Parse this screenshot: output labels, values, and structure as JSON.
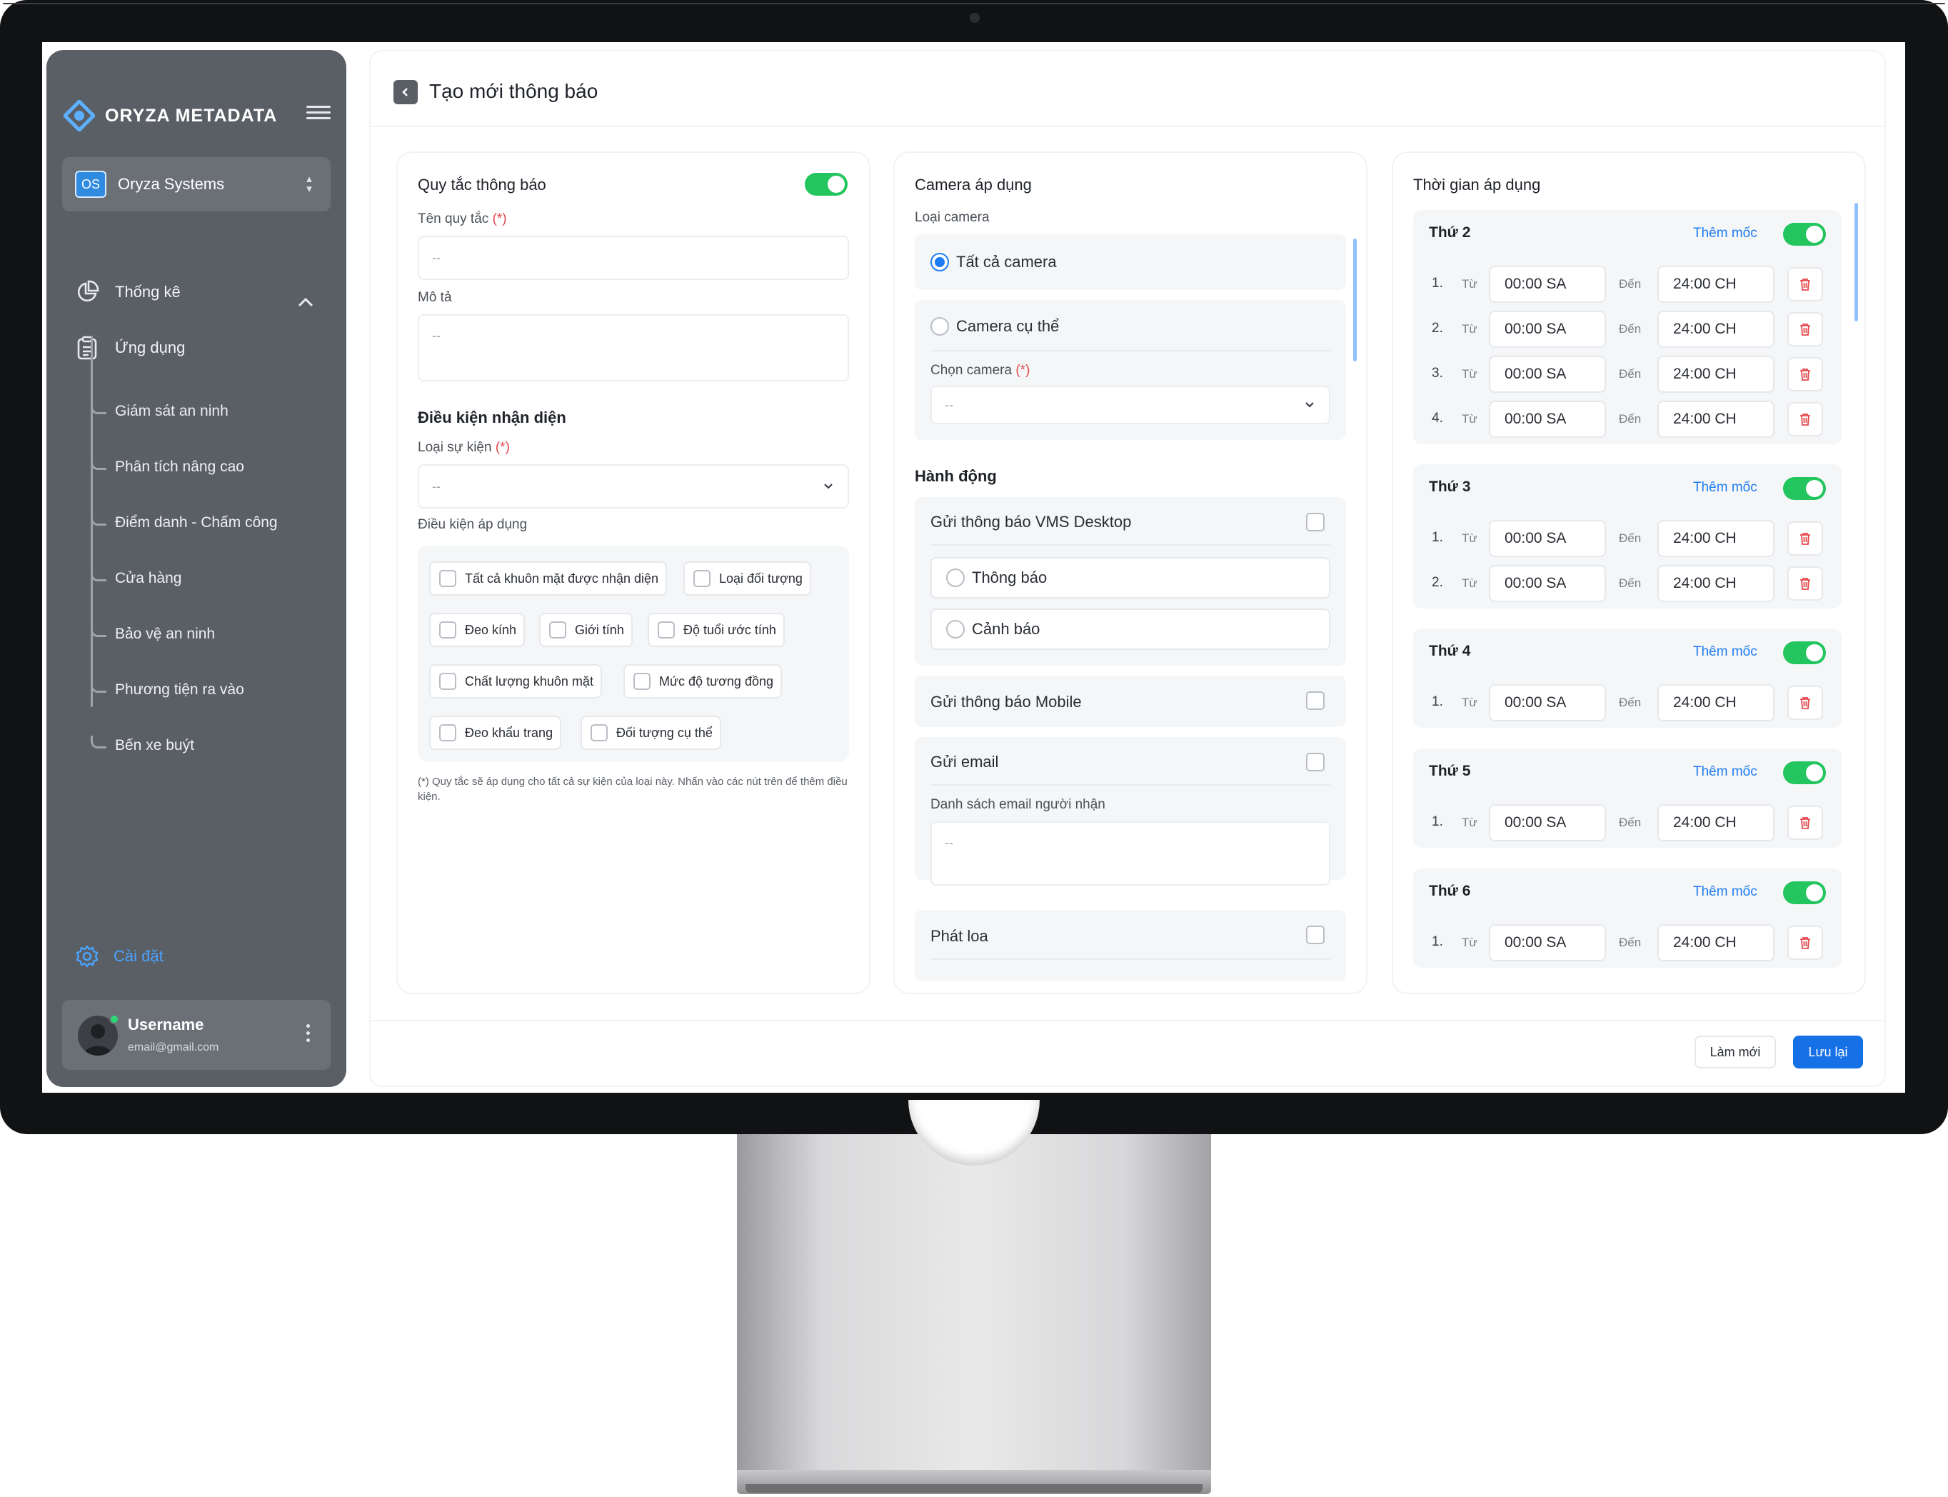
{
  "brand": {
    "name": "ORYZA METADATA"
  },
  "org": {
    "badge": "OS",
    "name": "Oryza Systems"
  },
  "nav": {
    "stats": "Thống kê",
    "apps": "Ứng dụng",
    "sub_items": [
      "Giám sát an ninh",
      "Phân tích nâng cao",
      "Điểm danh - Chấm công",
      "Cửa hàng",
      "Bảo vệ an ninh",
      "Phương tiện ra vào",
      "Bến xe buýt"
    ],
    "settings": "Cài đặt"
  },
  "user": {
    "name": "Username",
    "email": "email@gmail.com"
  },
  "page": {
    "title": "Tạo mới thông báo"
  },
  "rule": {
    "title": "Quy tắc thông báo",
    "enabled": true,
    "name_label": "Tên quy tắc",
    "required_mark": "(*)",
    "name_placeholder": "--",
    "desc_label": "Mô tả",
    "desc_placeholder": "--",
    "detect_title": "Điều kiện nhận diện",
    "event_label": "Loại sự kiện",
    "event_value": "--",
    "apply_label": "Điều kiện áp dụng",
    "conditions": [
      "Tất cả khuôn mặt được nhận diện",
      "Loại đối tượng",
      "Đeo kính",
      "Giới tính",
      "Độ tuổi ước tính",
      "Chất lượng khuôn mặt",
      "Mức độ tương đồng",
      "Đeo khẩu trang",
      "Đối tượng cụ thể"
    ],
    "note": "(*) Quy tắc sẽ áp dụng cho tất cả sự kiện của loại này. Nhấn vào các nút trên để thêm điều kiện."
  },
  "camera": {
    "title": "Camera áp dụng",
    "type_label": "Loại camera",
    "all_cameras": "Tất cả camera",
    "specific_camera": "Camera cụ thể",
    "choose_label": "Chọn camera",
    "choose_value": "--",
    "selected": "all"
  },
  "actions": {
    "title": "Hành động",
    "vms_desktop": "Gửi thông báo VMS Desktop",
    "notify": "Thông báo",
    "warning": "Cảnh báo",
    "mobile": "Gửi thông báo Mobile",
    "email": "Gửi email",
    "email_list_label": "Danh sách email người nhận",
    "email_placeholder": "--",
    "speaker": "Phát loa"
  },
  "schedule": {
    "title": "Thời gian áp dụng",
    "add_label": "Thêm mốc",
    "from_label": "Từ",
    "to_label": "Đến",
    "days": [
      {
        "name": "Thứ 2",
        "enabled": true,
        "slots": [
          {
            "idx": "1.",
            "start": "00:00 SA",
            "end": "24:00 CH"
          },
          {
            "idx": "2.",
            "start": "00:00 SA",
            "end": "24:00 CH"
          },
          {
            "idx": "3.",
            "start": "00:00 SA",
            "end": "24:00 CH"
          },
          {
            "idx": "4.",
            "start": "00:00 SA",
            "end": "24:00 CH"
          }
        ]
      },
      {
        "name": "Thứ 3",
        "enabled": true,
        "slots": [
          {
            "idx": "1.",
            "start": "00:00 SA",
            "end": "24:00 CH"
          },
          {
            "idx": "2.",
            "start": "00:00 SA",
            "end": "24:00 CH"
          }
        ]
      },
      {
        "name": "Thứ 4",
        "enabled": true,
        "slots": [
          {
            "idx": "1.",
            "start": "00:00 SA",
            "end": "24:00 CH"
          }
        ]
      },
      {
        "name": "Thứ 5",
        "enabled": true,
        "slots": [
          {
            "idx": "1.",
            "start": "00:00 SA",
            "end": "24:00 CH"
          }
        ]
      },
      {
        "name": "Thứ 6",
        "enabled": true,
        "slots": [
          {
            "idx": "1.",
            "start": "00:00 SA",
            "end": "24:00 CH"
          }
        ]
      }
    ]
  },
  "footer": {
    "reset": "Làm mới",
    "save": "Lưu lại"
  },
  "colors": {
    "accent": "#1670e6",
    "toggle_on": "#22c55e",
    "sidebar": "#5a5e65",
    "danger": "#e5484d"
  }
}
